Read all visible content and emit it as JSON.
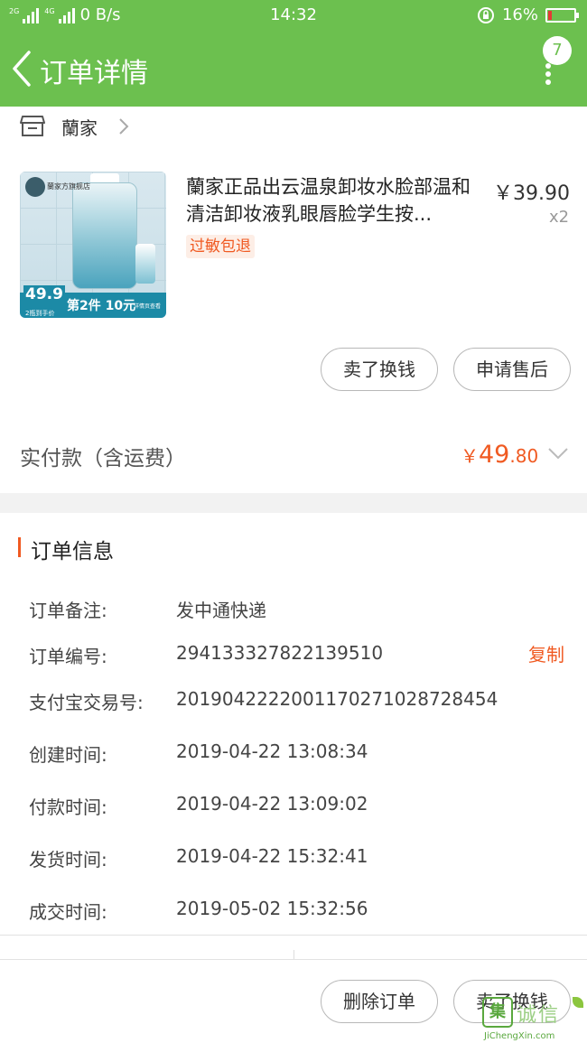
{
  "status_bar": {
    "net_2g": "2G",
    "net_4g": "4G",
    "speed": "0 B/s",
    "time": "14:32",
    "battery": "16%",
    "battery_level": 0.16
  },
  "header": {
    "title": "订单详情",
    "badge_count": "7",
    "accent_color": "#6cc04f"
  },
  "shop": {
    "name": "蘭家"
  },
  "product": {
    "title": "蘭家正品出云温泉卸妆水脸部温和清洁卸妆液乳眼唇脸学生按...",
    "price": "￥39.90",
    "quantity": "x2",
    "tag": "过敏包退",
    "image": {
      "store_label": "蘭家方旗舰店",
      "promo_price": "49.9",
      "promo_sub": "2瓶到手价",
      "promo_deal": "第2件 10元",
      "promo_note": "详情页查看"
    }
  },
  "item_actions": {
    "sell_label": "卖了换钱",
    "after_sale_label": "申请售后"
  },
  "payment": {
    "label": "实付款（含运费）",
    "currency": "￥",
    "amount_int": "49",
    "amount_dec": ".80",
    "price_color": "#f05a22"
  },
  "order_info": {
    "title": "订单信息",
    "copy_label": "复制",
    "rows": [
      {
        "label": "订单备注:",
        "value": "发中通快递"
      },
      {
        "label": "订单编号:",
        "value": "294133327822139510"
      },
      {
        "label": "支付宝交易号:",
        "value": "2019042222001170271028728454"
      },
      {
        "label": "创建时间:",
        "value": "2019-04-22 13:08:34"
      },
      {
        "label": "付款时间:",
        "value": "2019-04-22 13:09:02"
      },
      {
        "label": "发货时间:",
        "value": "2019-04-22 15:32:41"
      },
      {
        "label": "成交时间:",
        "value": "2019-05-02 15:32:56"
      }
    ]
  },
  "bottom_actions": {
    "delete_label": "删除订单",
    "sell_label": "卖了换钱"
  },
  "watermark": {
    "box_char": "集",
    "text": "诚信",
    "url": "JiChengXin.com"
  }
}
